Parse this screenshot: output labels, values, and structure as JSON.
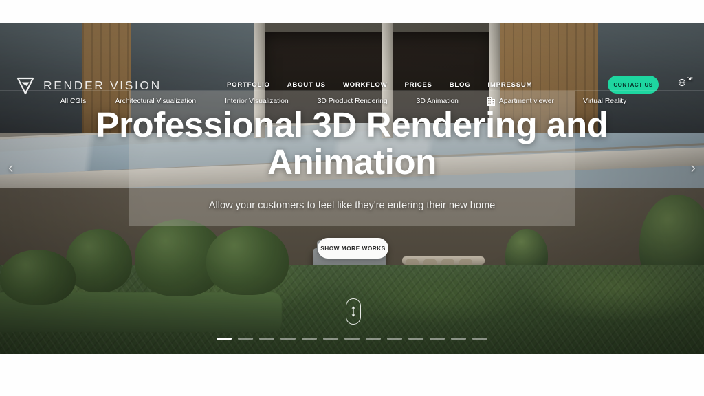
{
  "brand": {
    "name": "RENDER VISION",
    "logo_icon": "render-vision-logo-icon",
    "accent_color": "#1ed6a0"
  },
  "header": {
    "nav": [
      {
        "label": "PORTFOLIO"
      },
      {
        "label": "ABOUT US"
      },
      {
        "label": "WORKFLOW"
      },
      {
        "label": "PRICES"
      },
      {
        "label": "BLOG"
      },
      {
        "label": "IMPRESSUM"
      }
    ],
    "contact_button": "CONTACT US",
    "language": {
      "code": "DE",
      "icon": "globe-icon"
    }
  },
  "categories": [
    {
      "label": "All CGIs",
      "icon": null
    },
    {
      "label": "Architectural Visualization",
      "icon": null
    },
    {
      "label": "Interior Visualization",
      "icon": null
    },
    {
      "label": "3D Product Rendering",
      "icon": null
    },
    {
      "label": "3D Animation",
      "icon": null
    },
    {
      "label": "Apartment viewer",
      "icon": "building-icon"
    },
    {
      "label": "Virtual Reality",
      "icon": null
    }
  ],
  "hero": {
    "headline_line1": "Professional 3D Rendering and",
    "headline_line2": "Animation",
    "subheadline": "Allow your customers to feel like they're entering their new home",
    "cta_label": "SHOW MORE WORKS",
    "scroll_icon": "scroll-mouse-icon",
    "prev_arrow": "‹",
    "next_arrow": "›",
    "slides_total": 13,
    "active_slide": 1
  }
}
